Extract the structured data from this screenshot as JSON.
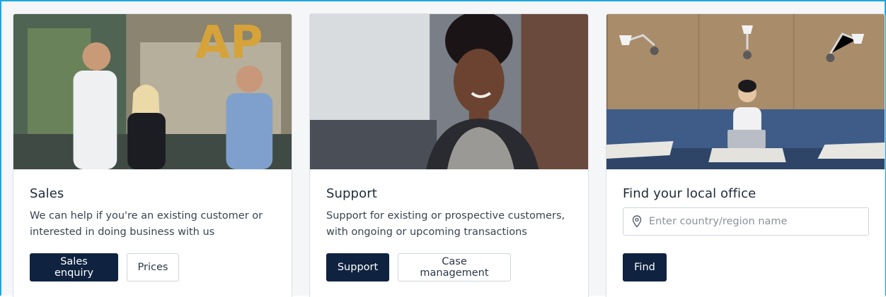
{
  "cards": [
    {
      "title": "Sales",
      "description": "We can help if you're an existing customer or interested in doing business with us",
      "primary_button": "Sales enquiry",
      "secondary_button": "Prices",
      "photo_overlay_text": "AP"
    },
    {
      "title": "Support",
      "description": "Support for existing or prospective customers, with ongoing or upcoming transactions",
      "primary_button": "Support",
      "secondary_button": "Case management"
    },
    {
      "title": "Find your local office",
      "search_placeholder": "Enter country/region name",
      "search_value": "",
      "primary_button": "Find"
    }
  ],
  "colors": {
    "accent_border": "#19a8e0",
    "primary_button": "#0f2340",
    "card_border": "#dcdfe4"
  },
  "icons": {
    "search_field_icon": "location-pin-icon"
  }
}
